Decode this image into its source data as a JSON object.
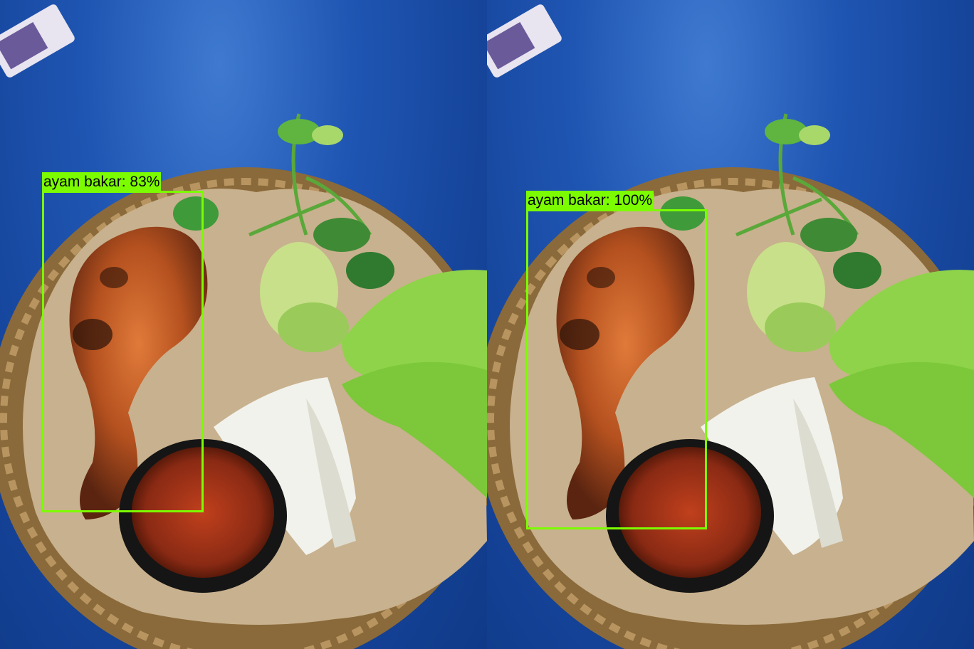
{
  "detections": [
    {
      "label": "ayam bakar",
      "confidence_text": "83%",
      "confidence": 0.83,
      "text": "ayam bakar: 83%"
    },
    {
      "label": "ayam bakar",
      "confidence_text": "100%",
      "confidence": 1.0,
      "text": "ayam bakar: 100%"
    }
  ],
  "colors": {
    "bbox": "#7cfc00",
    "label_text": "#000000",
    "table": "#1f56b3"
  },
  "scene": {
    "objects": [
      "wicker-basket",
      "brown-paper-liner",
      "grilled-chicken",
      "sambal-bowl",
      "cabbage-leaves",
      "lettuce",
      "cucumber-slices",
      "basil-leaves"
    ]
  }
}
